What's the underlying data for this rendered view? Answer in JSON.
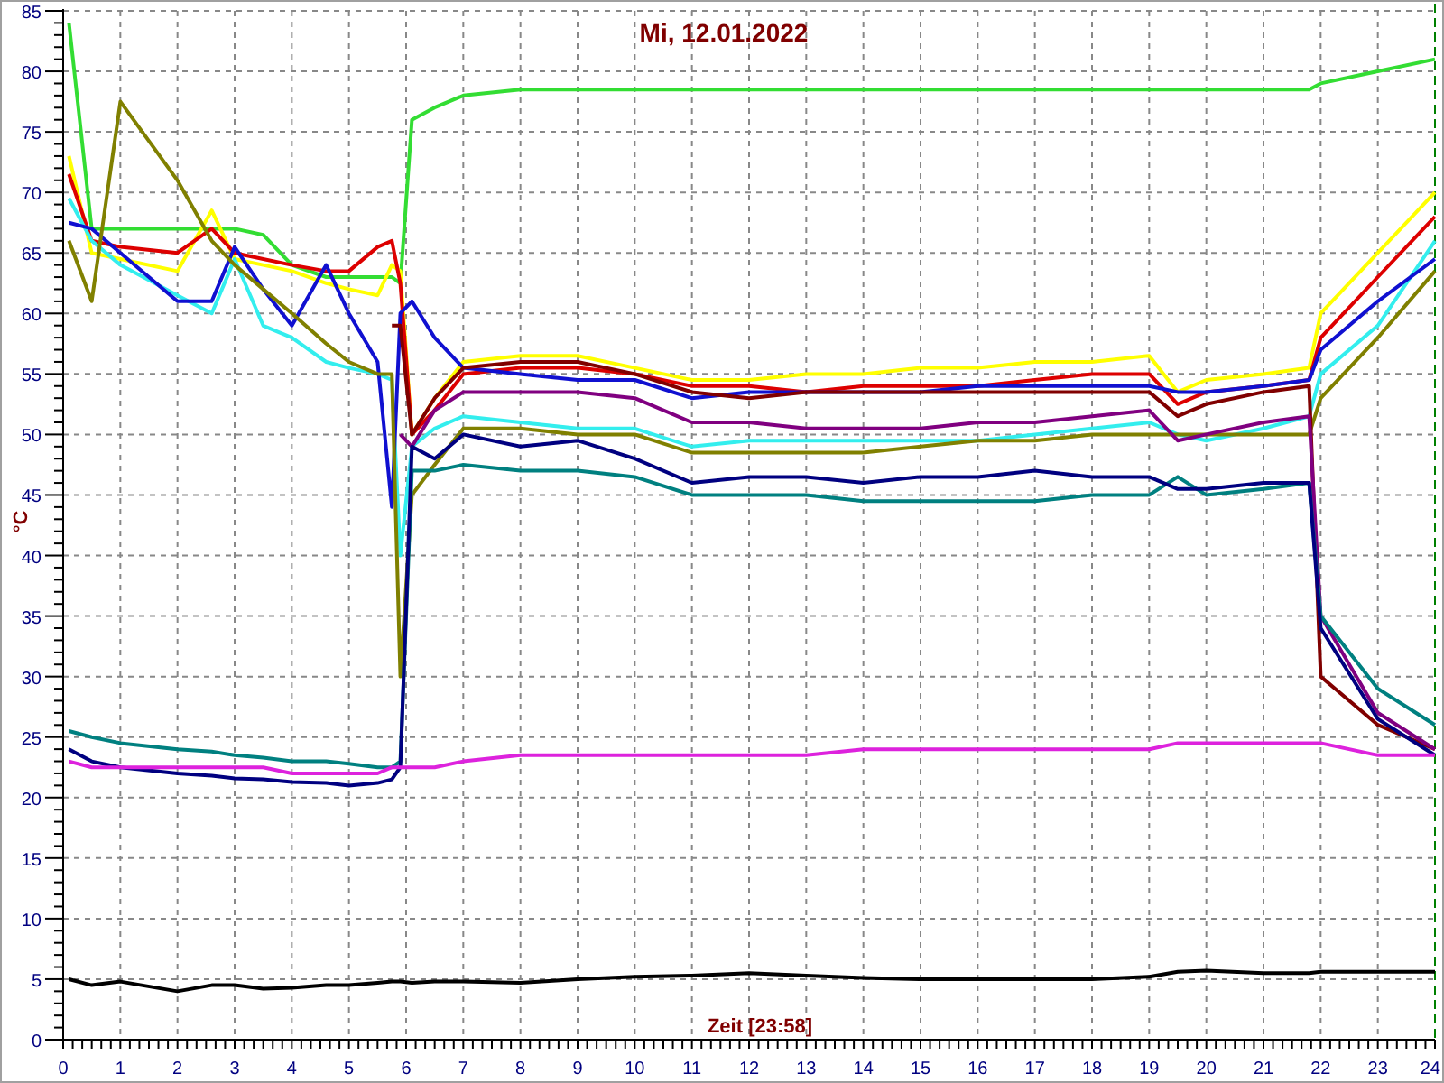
{
  "chart_data": {
    "type": "line",
    "title": "Mi, 12.01.2022",
    "xlabel": "Zeit [23:58]",
    "ylabel": "°C",
    "x": [
      0.1,
      0.5,
      1,
      2,
      2.6,
      3,
      3.5,
      4,
      4.6,
      5,
      5.5,
      5.75,
      5.9,
      6.1,
      6.5,
      7,
      8,
      9,
      10,
      11,
      12,
      13,
      14,
      15,
      16,
      17,
      18,
      19,
      19.5,
      20,
      21,
      21.8,
      22,
      23,
      24
    ],
    "series": [
      {
        "color": "#33dd33",
        "values": [
          84,
          67,
          67,
          67,
          67,
          67,
          66.5,
          64,
          63,
          63,
          63,
          63,
          62.5,
          76,
          77,
          78,
          78.5,
          78.5,
          78.5,
          78.5,
          78.5,
          78.5,
          78.5,
          78.5,
          78.5,
          78.5,
          78.5,
          78.5,
          78.5,
          78.5,
          78.5,
          78.5,
          79,
          80,
          81
        ]
      },
      {
        "color": "#ffff00",
        "values": [
          73,
          65,
          64.5,
          63.5,
          68.5,
          64.5,
          64,
          63.5,
          62.5,
          62,
          61.5,
          64,
          63.5,
          50,
          53,
          56,
          56.5,
          56.5,
          55.5,
          54.5,
          54.5,
          55,
          55,
          55.5,
          55.5,
          56,
          56,
          56.5,
          53.5,
          54.5,
          55,
          55.5,
          60,
          65,
          70
        ]
      },
      {
        "color": "#dd0000",
        "values": [
          71.5,
          66,
          65.5,
          65,
          67,
          65,
          64.5,
          64,
          63.5,
          63.5,
          65.5,
          66,
          62.5,
          50,
          52,
          55,
          55.5,
          55.5,
          55,
          54,
          54,
          53.5,
          54,
          54,
          54,
          54.5,
          55,
          55,
          52.5,
          53.5,
          54,
          54.5,
          58,
          63,
          68
        ]
      },
      {
        "color": "#33eeee",
        "values": [
          69.5,
          66,
          64,
          61.5,
          60,
          64.5,
          59,
          58,
          56,
          55.5,
          55,
          54.5,
          40,
          49,
          50.5,
          51.5,
          51,
          50.5,
          50.5,
          49,
          49.5,
          49.5,
          49.5,
          49.5,
          49.5,
          50,
          50.5,
          51,
          50,
          49.5,
          50.5,
          51.5,
          55,
          59,
          66
        ]
      },
      {
        "color": "#1010d0",
        "values": [
          67.5,
          67,
          65,
          61,
          61,
          65.5,
          62,
          59,
          64,
          60,
          56,
          44,
          60,
          61,
          58,
          55.5,
          55,
          54.5,
          54.5,
          53,
          53.5,
          53.5,
          53.5,
          53.5,
          54,
          54,
          54,
          54,
          53.5,
          53.5,
          54,
          54.5,
          57,
          61,
          64.5
        ]
      },
      {
        "color": "#808000",
        "values": [
          66,
          61,
          77.5,
          71,
          66,
          64,
          62,
          60,
          57.5,
          56,
          55,
          55,
          30,
          45,
          47.5,
          50.5,
          50.5,
          50,
          50,
          48.5,
          48.5,
          48.5,
          48.5,
          49,
          49.5,
          49.5,
          50,
          50,
          50,
          50,
          50,
          50,
          53,
          58,
          63.5
        ]
      },
      {
        "color": "#800000",
        "values": [
          null,
          null,
          null,
          null,
          null,
          null,
          null,
          null,
          null,
          null,
          null,
          59,
          59,
          50,
          53,
          55.5,
          56,
          56,
          55,
          53.5,
          53,
          53.5,
          53.5,
          53.5,
          53.5,
          53.5,
          53.5,
          53.5,
          51.5,
          52.5,
          53.5,
          54,
          30,
          26,
          24
        ]
      },
      {
        "color": "#800080",
        "values": [
          null,
          null,
          null,
          null,
          null,
          null,
          null,
          null,
          null,
          null,
          null,
          null,
          50,
          49,
          52,
          53.5,
          53.5,
          53.5,
          53,
          51,
          51,
          50.5,
          50.5,
          50.5,
          51,
          51,
          51.5,
          52,
          49.5,
          50,
          51,
          51.5,
          35,
          27,
          24
        ]
      },
      {
        "color": "#008080",
        "values": [
          25.5,
          25,
          24.5,
          24,
          23.8,
          23.5,
          23.3,
          23,
          23,
          22.8,
          22.5,
          22.5,
          23,
          47,
          47,
          47.5,
          47,
          47,
          46.5,
          45,
          45,
          45,
          44.5,
          44.5,
          44.5,
          44.5,
          45,
          45,
          46.5,
          45,
          45.5,
          46,
          35,
          29,
          26
        ]
      },
      {
        "color": "#000080",
        "values": [
          24,
          23,
          22.5,
          22,
          21.8,
          21.6,
          21.5,
          21.3,
          21.2,
          21,
          21.2,
          21.5,
          22.5,
          49,
          48,
          50,
          49,
          49.5,
          48,
          46,
          46.5,
          46.5,
          46,
          46.5,
          46.5,
          47,
          46.5,
          46.5,
          45.5,
          45.5,
          46,
          46,
          34,
          26.5,
          23.5
        ]
      },
      {
        "color": "#dd22dd",
        "values": [
          23,
          22.5,
          22.5,
          22.5,
          22.5,
          22.5,
          22.5,
          22,
          22,
          22,
          22,
          22.5,
          22.5,
          22.5,
          22.5,
          23,
          23.5,
          23.5,
          23.5,
          23.5,
          23.5,
          23.5,
          24,
          24,
          24,
          24,
          24,
          24,
          24.5,
          24.5,
          24.5,
          24.5,
          24.5,
          23.5,
          23.5
        ]
      },
      {
        "color": "#000000",
        "values": [
          5,
          4.5,
          4.8,
          4,
          4.5,
          4.5,
          4.2,
          4.3,
          4.5,
          4.5,
          4.7,
          4.8,
          4.8,
          4.7,
          4.8,
          4.8,
          4.7,
          5,
          5.2,
          5.3,
          5.5,
          5.3,
          5.1,
          5,
          5,
          5,
          5,
          5.2,
          5.6,
          5.7,
          5.5,
          5.5,
          5.6,
          5.6,
          5.6
        ]
      }
    ],
    "grid": true,
    "xlim": [
      0,
      24
    ],
    "ylim": [
      0,
      85
    ],
    "xticks": [
      0,
      1,
      2,
      3,
      4,
      5,
      6,
      7,
      8,
      9,
      10,
      11,
      12,
      13,
      14,
      15,
      16,
      17,
      18,
      19,
      20,
      21,
      22,
      23,
      24
    ],
    "yticks": [
      0,
      5,
      10,
      15,
      20,
      25,
      30,
      35,
      40,
      45,
      50,
      55,
      60,
      65,
      70,
      75,
      80,
      85
    ]
  }
}
